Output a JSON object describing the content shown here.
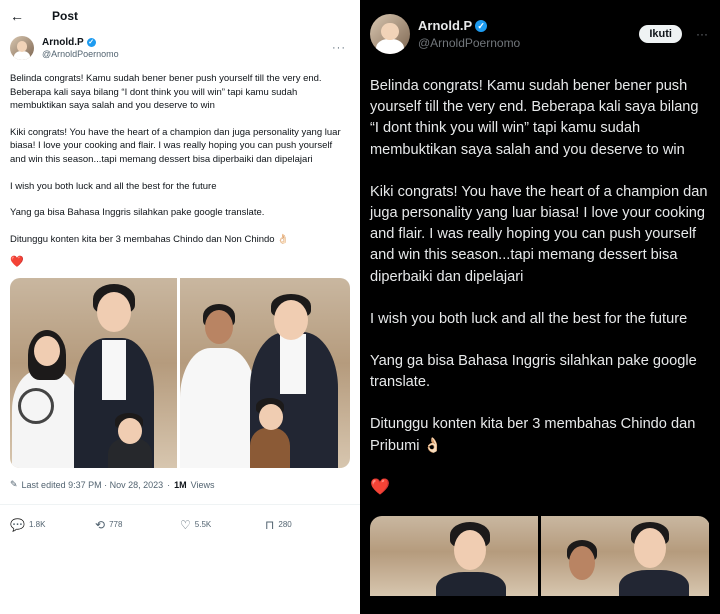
{
  "left": {
    "header": {
      "back_icon": "back-arrow-icon",
      "title": "Post"
    },
    "author": {
      "name": "Arnold.P",
      "handle": "@ArnoldPoernomo",
      "verified_icon": "verified-badge-icon",
      "more_icon": "more-icon",
      "more_glyph": "···"
    },
    "tweet": {
      "paragraphs": [
        "Belinda congrats! Kamu sudah bener bener push yourself till the very end. Beberapa kali saya bilang “I dont think you will win” tapi kamu sudah membuktikan saya salah and you deserve to win",
        "Kiki congrats! You have the heart of a champion dan juga personality yang luar biasa! I love your cooking and flair. I was really hoping you can push yourself and win this season...tapi memang dessert bisa diperbaiki dan dipelajari",
        "I wish you both luck and all the best for the future",
        "Yang ga bisa Bahasa Inggris silahkan pake google translate.",
        "Ditunggu konten kita ber 3 membahas Chindo dan Non Chindo 👌🏻"
      ],
      "heart": "❤️"
    },
    "meta": {
      "edit_icon": "pencil-icon",
      "edited": "Last edited 9:37 PM · Nov 28, 2023",
      "dot": "·",
      "views_count": "1M",
      "views_label": "Views"
    },
    "actions": [
      {
        "icon": "reply-icon",
        "glyph": "💬",
        "count": "1.8K"
      },
      {
        "icon": "retweet-icon",
        "glyph": "⟲",
        "count": "778"
      },
      {
        "icon": "like-icon",
        "glyph": "♡",
        "count": "5.5K"
      },
      {
        "icon": "bookmark-icon",
        "glyph": "⊓",
        "count": "280"
      }
    ]
  },
  "right": {
    "author": {
      "name": "Arnold.P",
      "handle": "@ArnoldPoernomo",
      "verified_icon": "verified-badge-icon",
      "follow_label": "Ikuti",
      "more_glyph": "···"
    },
    "tweet": {
      "paragraphs": [
        "Belinda congrats! Kamu sudah bener bener push yourself till the very end. Beberapa kali saya bilang “I dont think you will win” tapi kamu sudah membuktikan saya salah and you deserve to win",
        "Kiki congrats! You have the heart of a champion dan juga personality yang luar biasa! I love your cooking and flair. I was really hoping you can push yourself and win this season...tapi memang dessert bisa diperbaiki dan dipelajari",
        "I wish you both luck and all the best for the future",
        "Yang ga bisa Bahasa Inggris silahkan pake google translate.",
        "Ditunggu konten kita ber 3 membahas Chindo dan Pribumi 👌🏻"
      ],
      "heart": "❤️"
    }
  },
  "colors": {
    "accent": "#1d9bf0",
    "heart": "#e0245e",
    "muted": "#536471",
    "dark_bg": "#000000"
  }
}
